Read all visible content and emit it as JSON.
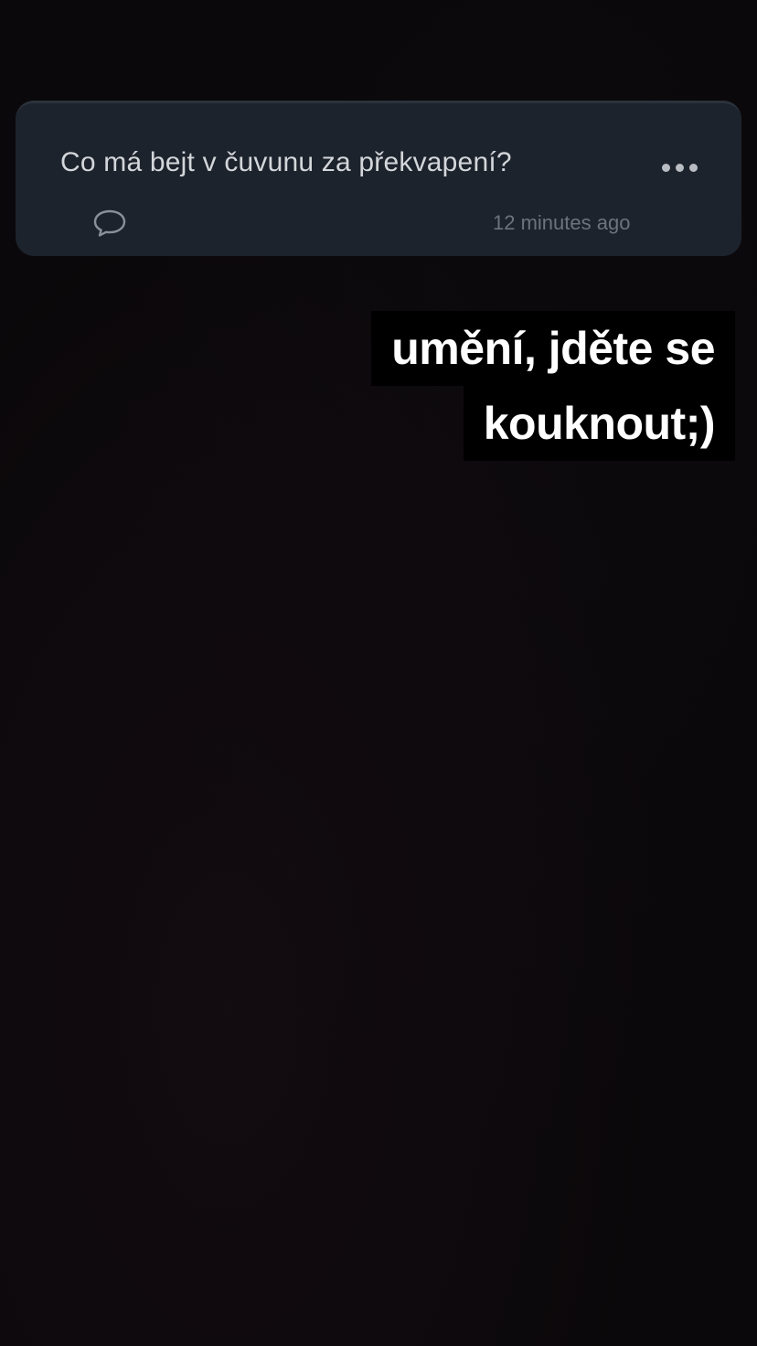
{
  "question_card": {
    "question": "Co má bejt v čuvunu za překvapení?",
    "timestamp": "12 minutes ago",
    "more_icon": "more-horizontal-icon",
    "comment_icon": "speech-bubble-icon"
  },
  "caption": {
    "lines": [
      "umění, jděte se",
      "kouknout;)"
    ]
  },
  "colors": {
    "background": "#0a080a",
    "card": "#1d232c",
    "question_text": "#d3d6da",
    "timestamp_text": "#6c737d",
    "caption_bg": "#000000",
    "caption_text": "#ffffff"
  }
}
